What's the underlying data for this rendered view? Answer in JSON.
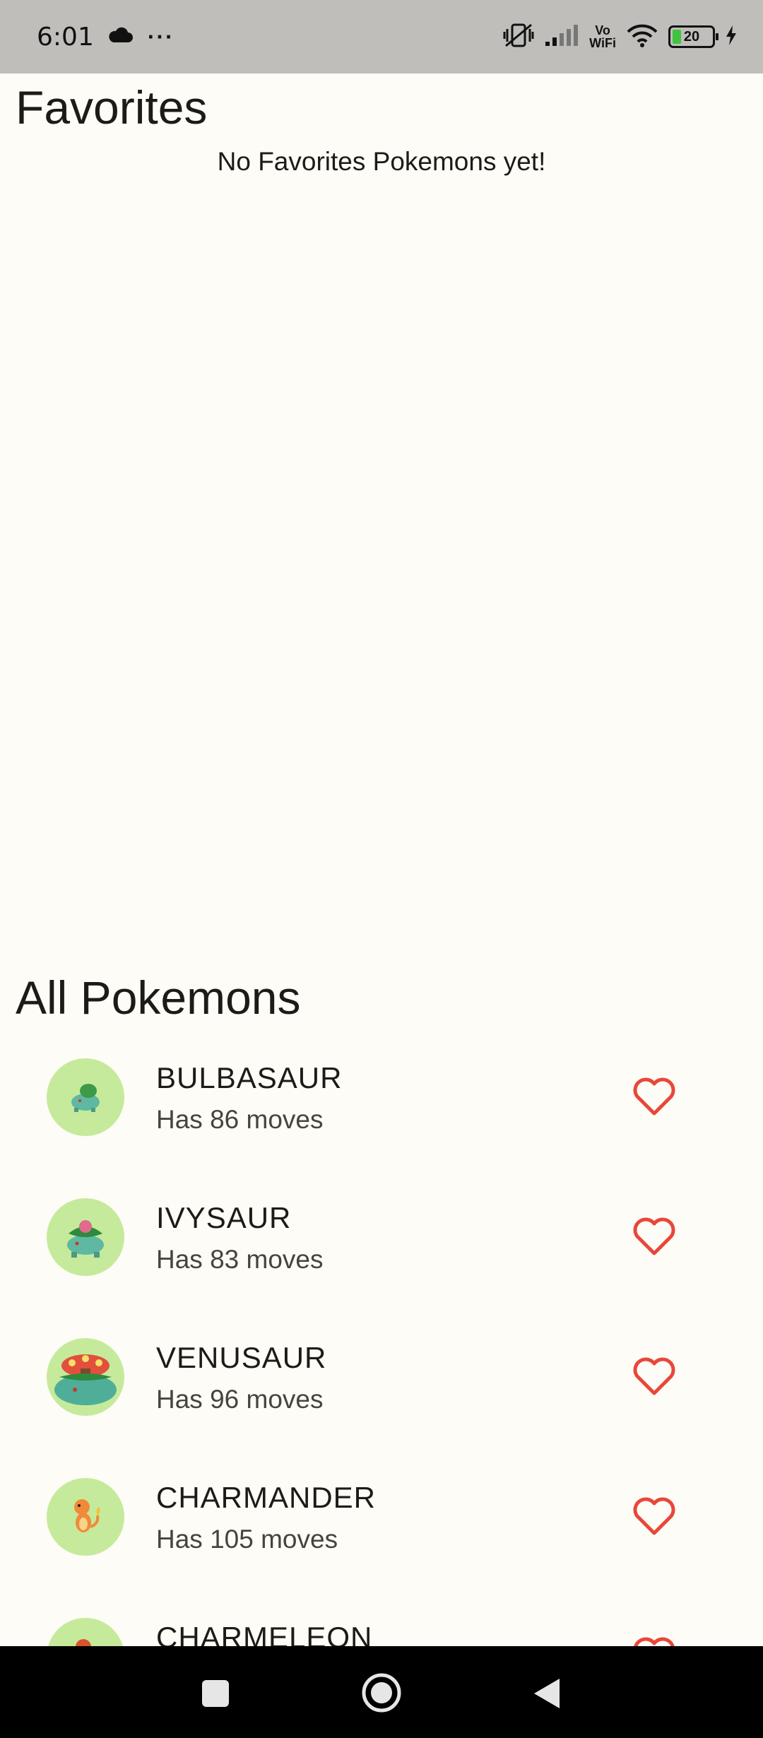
{
  "status_bar": {
    "time": "6:01",
    "more": "···",
    "vowifi_top": "Vo",
    "vowifi_bottom": "WiFi",
    "battery_level": "20"
  },
  "favorites": {
    "title": "Favorites",
    "empty_message": "No Favorites Pokemons yet!"
  },
  "all_pokemons": {
    "title": "All Pokemons",
    "items": [
      {
        "name": "BULBASAUR",
        "moves": "Has 86 moves"
      },
      {
        "name": "IVYSAUR",
        "moves": "Has 83 moves"
      },
      {
        "name": "VENUSAUR",
        "moves": "Has 96 moves"
      },
      {
        "name": "CHARMANDER",
        "moves": "Has 105 moves"
      },
      {
        "name": "CHARMELEON",
        "moves": ""
      }
    ]
  },
  "colors": {
    "accent_heart": "#e8473a",
    "avatar_bg": "#c6ea9b",
    "background": "#fdfcf6"
  }
}
